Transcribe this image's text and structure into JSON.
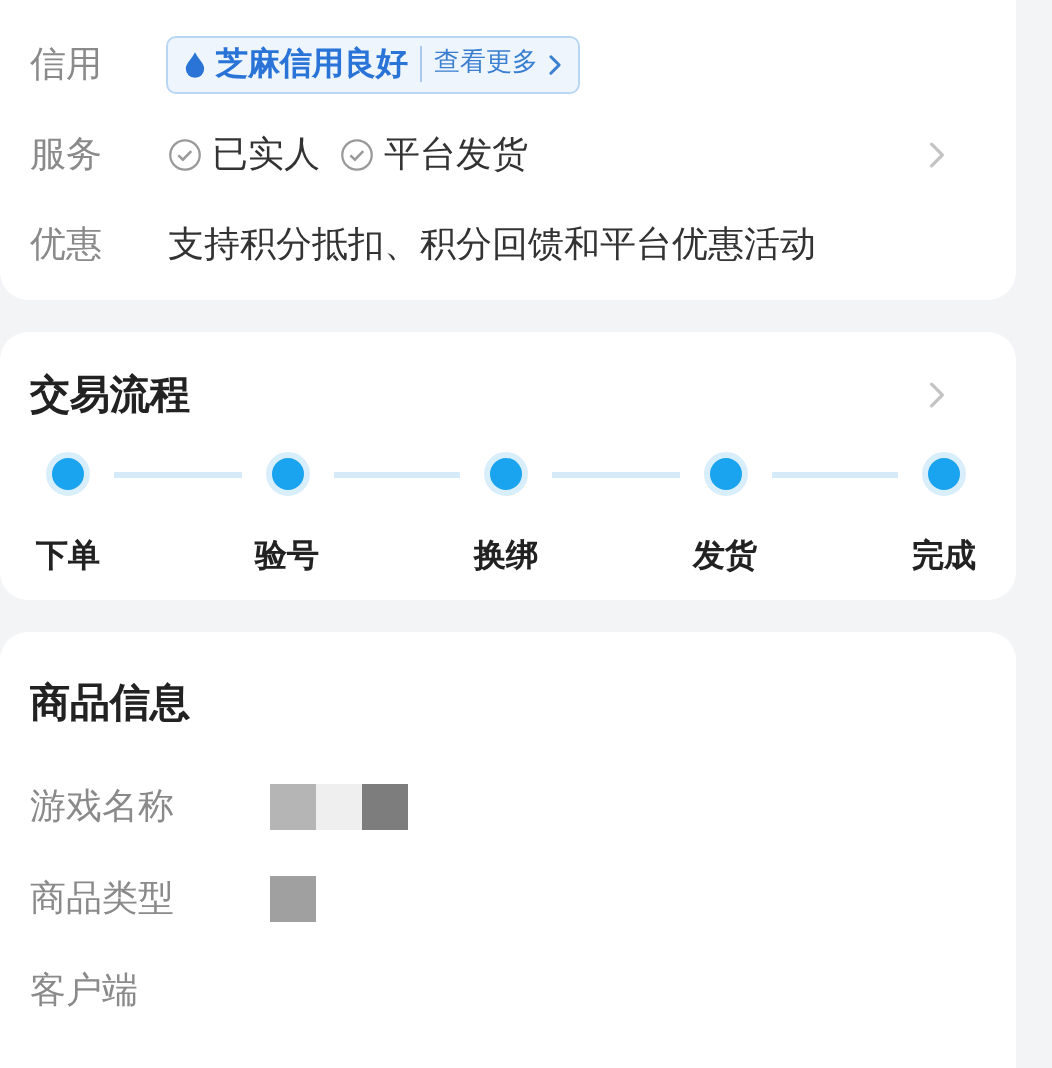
{
  "credit": {
    "label": "信用",
    "badge": "芝麻信用良好",
    "link": "查看更多"
  },
  "services": {
    "label": "服务",
    "items": [
      "已实人",
      "平台发货"
    ]
  },
  "discount": {
    "label": "优惠",
    "text": "支持积分抵扣、积分回馈和平台优惠活动"
  },
  "process": {
    "title": "交易流程",
    "steps": [
      "下单",
      "验号",
      "换绑",
      "发货",
      "完成"
    ]
  },
  "product": {
    "title": "商品信息",
    "rows": [
      {
        "label": "游戏名称",
        "redacted": true
      },
      {
        "label": "商品类型",
        "redacted": true
      },
      {
        "label": "客户端",
        "redacted": false
      }
    ]
  }
}
